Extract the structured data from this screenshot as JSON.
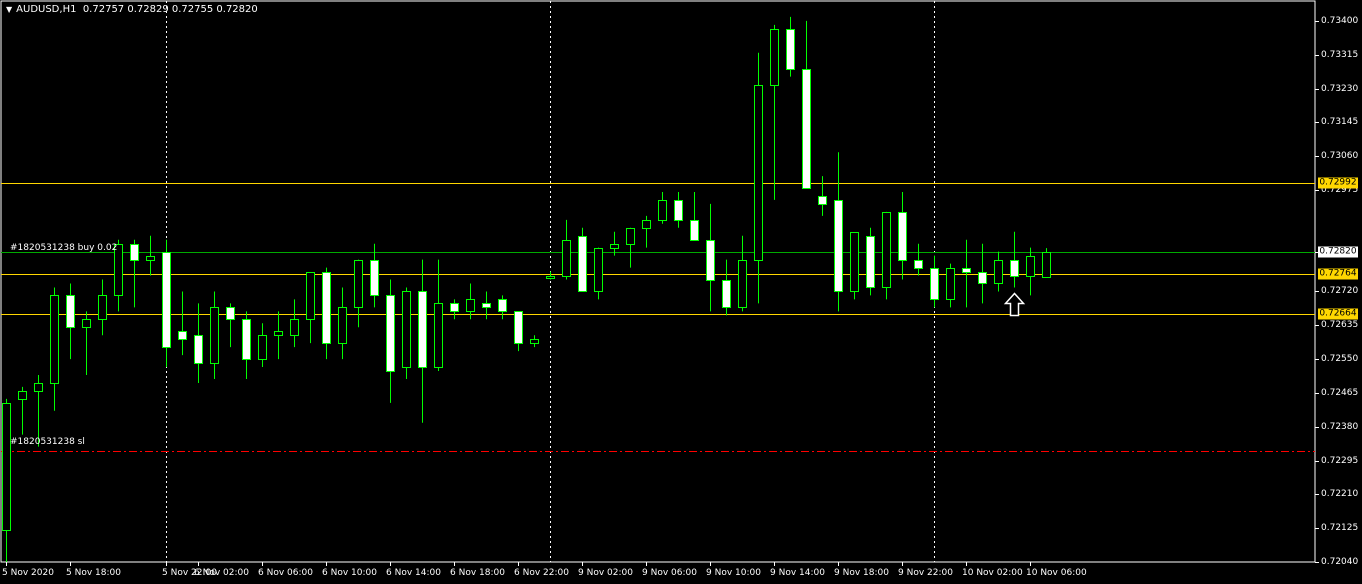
{
  "header": {
    "menu_icon": "triangle-down-icon",
    "symbol_timeframe": "AUDUSD,H1",
    "ohlc": "0.72757 0.72829 0.72755 0.72820"
  },
  "trade_labels": {
    "buy": "#1820531238 buy 0.02",
    "sl": "#1820531238 sl"
  },
  "colors": {
    "background": "#000000",
    "bull_body": "#000000",
    "bull_wick": "#00ff00",
    "bear_body": "#ffffff",
    "bear_outline": "#00ff00",
    "grid": "#ffffff",
    "level_line": "#ffd700",
    "buy_line": "#00aa00",
    "sl_line": "#ff0000",
    "badge_bg": "#ffd700"
  },
  "chart_data": {
    "type": "candlestick",
    "symbol": "AUDUSD",
    "timeframe": "H1",
    "ylim": [
      0.7204,
      0.7345
    ],
    "y_ticks": [
      "0.73400",
      "0.73315",
      "0.73230",
      "0.73145",
      "0.73060",
      "0.72975",
      "0.72905",
      "0.72820",
      "0.72720",
      "0.72635",
      "0.72550",
      "0.72465",
      "0.72380",
      "0.72295",
      "0.72210",
      "0.72125",
      "0.72040"
    ],
    "x_ticks": [
      "5 Nov 2020",
      "5 Nov 18:00",
      "5 Nov 22:00",
      "6 Nov 02:00",
      "6 Nov 06:00",
      "6 Nov 10:00",
      "6 Nov 14:00",
      "6 Nov 18:00",
      "6 Nov 22:00",
      "9 Nov 02:00",
      "9 Nov 06:00",
      "9 Nov 10:00",
      "9 Nov 14:00",
      "9 Nov 18:00",
      "9 Nov 22:00",
      "10 Nov 02:00",
      "10 Nov 06:00"
    ],
    "x_tick_slots": [
      0,
      4,
      10,
      12,
      16,
      20,
      24,
      28,
      32,
      36,
      40,
      44,
      48,
      52,
      56,
      60,
      64
    ],
    "period_separator_slots": [
      10,
      34,
      58
    ],
    "candles": [
      [
        0.7212,
        0.7245,
        0.7204,
        0.7244
      ],
      [
        0.7245,
        0.7248,
        0.7236,
        0.7247
      ],
      [
        0.7247,
        0.7251,
        0.7233,
        0.7249
      ],
      [
        0.7249,
        0.7273,
        0.7242,
        0.7271
      ],
      [
        0.7271,
        0.7274,
        0.7255,
        0.7263
      ],
      [
        0.7263,
        0.7267,
        0.7251,
        0.7265
      ],
      [
        0.7265,
        0.7275,
        0.7261,
        0.7271
      ],
      [
        0.7271,
        0.7285,
        0.7267,
        0.7284
      ],
      [
        0.7284,
        0.7285,
        0.7268,
        0.728
      ],
      [
        0.728,
        0.7286,
        0.7276,
        0.7281
      ],
      [
        0.7282,
        0.7285,
        0.7253,
        0.7258
      ],
      [
        0.7262,
        0.7272,
        0.7256,
        0.726
      ],
      [
        0.7261,
        0.7269,
        0.7249,
        0.7254
      ],
      [
        0.7254,
        0.7272,
        0.725,
        0.7268
      ],
      [
        0.7268,
        0.7269,
        0.7258,
        0.7265
      ],
      [
        0.7265,
        0.7267,
        0.725,
        0.7255
      ],
      [
        0.7255,
        0.7264,
        0.7253,
        0.7261
      ],
      [
        0.7261,
        0.7267,
        0.7255,
        0.7262
      ],
      [
        0.7261,
        0.727,
        0.7258,
        0.7265
      ],
      [
        0.7265,
        0.7276,
        0.7259,
        0.7277
      ],
      [
        0.7277,
        0.7278,
        0.7255,
        0.7259
      ],
      [
        0.7259,
        0.7273,
        0.7255,
        0.7268
      ],
      [
        0.7268,
        0.728,
        0.7263,
        0.728
      ],
      [
        0.728,
        0.7284,
        0.7268,
        0.7271
      ],
      [
        0.7271,
        0.7275,
        0.7244,
        0.7252
      ],
      [
        0.7253,
        0.7273,
        0.725,
        0.7272
      ],
      [
        0.7272,
        0.728,
        0.7239,
        0.7253
      ],
      [
        0.7253,
        0.728,
        0.7252,
        0.7269
      ],
      [
        0.7269,
        0.727,
        0.7265,
        0.7267
      ],
      [
        0.7267,
        0.7274,
        0.7265,
        0.727
      ],
      [
        0.7269,
        0.7272,
        0.7265,
        0.7268
      ],
      [
        0.727,
        0.7271,
        0.7265,
        0.7267
      ],
      [
        0.7267,
        0.7267,
        0.7257,
        0.7259
      ],
      [
        0.7259,
        0.7261,
        0.7258,
        0.726
      ],
      [
        0.7276,
        0.7277,
        0.7275,
        0.7276
      ],
      [
        0.7276,
        0.729,
        0.7275,
        0.7285
      ],
      [
        0.7286,
        0.7288,
        0.7272,
        0.7272
      ],
      [
        0.7272,
        0.7283,
        0.727,
        0.7283
      ],
      [
        0.7283,
        0.7287,
        0.7281,
        0.7284
      ],
      [
        0.7284,
        0.7288,
        0.7278,
        0.7288
      ],
      [
        0.7288,
        0.7291,
        0.7283,
        0.729
      ],
      [
        0.729,
        0.7297,
        0.7289,
        0.7295
      ],
      [
        0.7295,
        0.7297,
        0.7288,
        0.729
      ],
      [
        0.729,
        0.7297,
        0.7286,
        0.7285
      ],
      [
        0.7285,
        0.7294,
        0.7267,
        0.7275
      ],
      [
        0.7275,
        0.728,
        0.7266,
        0.7268
      ],
      [
        0.7268,
        0.7286,
        0.7267,
        0.728
      ],
      [
        0.728,
        0.7332,
        0.7269,
        0.7324
      ],
      [
        0.7324,
        0.7339,
        0.7295,
        0.7338
      ],
      [
        0.7338,
        0.7341,
        0.7326,
        0.7328
      ],
      [
        0.7328,
        0.734,
        0.7298,
        0.7298
      ],
      [
        0.7296,
        0.7301,
        0.7291,
        0.7294
      ],
      [
        0.7295,
        0.7307,
        0.7267,
        0.7272
      ],
      [
        0.7272,
        0.7286,
        0.727,
        0.7287
      ],
      [
        0.7286,
        0.7288,
        0.7271,
        0.7273
      ],
      [
        0.7273,
        0.7292,
        0.727,
        0.7292
      ],
      [
        0.7292,
        0.7297,
        0.7275,
        0.728
      ],
      [
        0.728,
        0.7284,
        0.7276,
        0.7278
      ],
      [
        0.7278,
        0.7281,
        0.7268,
        0.727
      ],
      [
        0.727,
        0.7279,
        0.7268,
        0.7278
      ],
      [
        0.7278,
        0.7285,
        0.7268,
        0.7277
      ],
      [
        0.7277,
        0.7284,
        0.7269,
        0.7274
      ],
      [
        0.7274,
        0.7282,
        0.7272,
        0.728
      ],
      [
        0.728,
        0.7287,
        0.7273,
        0.7276
      ],
      [
        0.7276,
        0.7283,
        0.7271,
        0.7281
      ],
      [
        0.72757,
        0.72829,
        0.72755,
        0.7282
      ]
    ],
    "arrow_candle_index": 63,
    "horizontal_levels": [
      {
        "price": 0.72992,
        "label": "0.72992",
        "kind": "level"
      },
      {
        "price": 0.7282,
        "label": "0.72820",
        "kind": "buy"
      },
      {
        "price": 0.72764,
        "label": "0.72764",
        "kind": "level"
      },
      {
        "price": 0.72664,
        "label": "0.72664",
        "kind": "level"
      },
      {
        "price": 0.72318,
        "label": "",
        "kind": "sl"
      }
    ],
    "current_price_label": "0.72820",
    "hidden_tick_label": "0.72905"
  }
}
